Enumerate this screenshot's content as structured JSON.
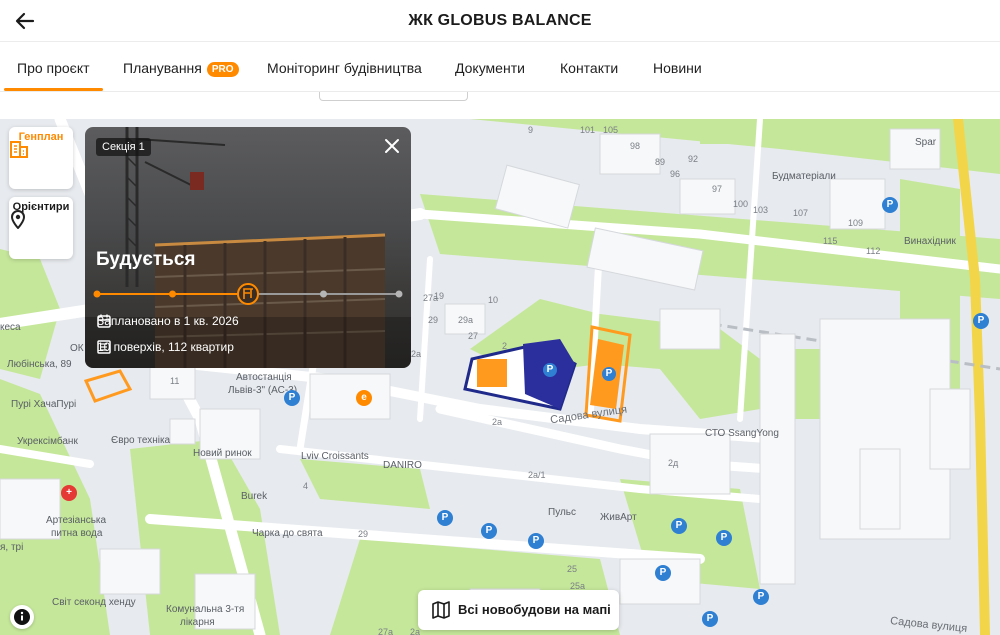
{
  "header": {
    "title": "ЖК GLOBUS BALANCE",
    "back_icon": "arrow-left-icon"
  },
  "tabs": [
    {
      "label": "Про проєкт",
      "active": true
    },
    {
      "label": "Планування",
      "badge": "PRO"
    },
    {
      "label": "Моніторинг будівництва"
    },
    {
      "label": "Документи"
    },
    {
      "label": "Контакти"
    },
    {
      "label": "Новини"
    }
  ],
  "side_controls": {
    "genplan": {
      "label": "Генплан",
      "icon": "building-grid-icon"
    },
    "orientiry": {
      "label": "Орієнтири",
      "icon": "map-pin-icon"
    }
  },
  "card": {
    "section_chip": "Секція 1",
    "status": "Будується",
    "progress_stage": 3,
    "progress_total": 5,
    "planned": "Заплановано в 1 кв. 2026",
    "floors": "10 поверхів, 112 квартир"
  },
  "map": {
    "labels": {
      "budmaterialy": "Будматеріали",
      "vynakhidnyk": "Винахідник",
      "spar": "Spar",
      "avtostantsiya": "Автостанція",
      "avtostantsiya2": "Львів-3\" (АС-3)",
      "lyubinska": "Любінська, 89",
      "khachapuri": "Пурі ХачаПурі",
      "ukreksimbank": "Укрексімбанк",
      "evro_tekhnika": "Євро техніка",
      "novyi_rynok": "Новий ринок",
      "lviv_croissants": "Lviv Croissants",
      "daniro": "DANIRO",
      "sadova": "Садова вулиця",
      "sadova2": "Садова вулиця",
      "sto": "СТО SsangYong",
      "pulse": "Пульс",
      "zhyvart": "ЖивАрт",
      "burek": "Burek",
      "charka": "Чарка до свята",
      "artezianska": "Артезіанська",
      "pytna_voda": "питна вода",
      "rii": "я, трі",
      "svit_sekond": "Світ секонд хенду",
      "komunalna": "Комунальна 3-тя",
      "likarnya": "лікарня",
      "kesa": "кеса",
      "ok": "ОК"
    },
    "numbers": [
      "89",
      "92",
      "97",
      "100",
      "103",
      "107",
      "109",
      "112",
      "101",
      "105",
      "9",
      "98",
      "96",
      "115",
      "19",
      "10",
      "27а",
      "29",
      "29а",
      "27",
      "2а",
      "2",
      "11",
      "2а",
      "2д",
      "2а/1",
      "29",
      "25",
      "25а",
      "27а",
      "2а",
      "4"
    ],
    "show_all_button": "Всі новобудови на мапі"
  }
}
